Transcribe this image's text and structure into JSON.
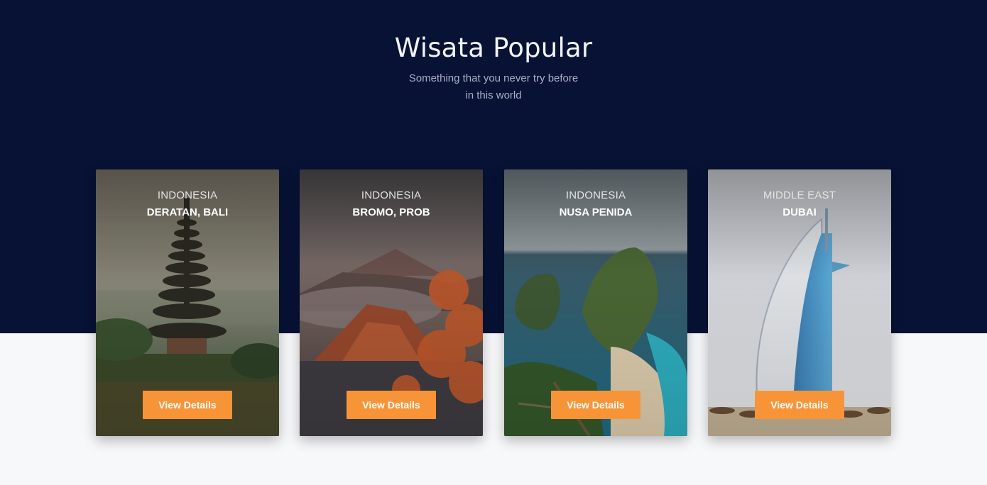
{
  "section": {
    "title": "Wisata Popular",
    "subtitle": "Something that you never try before in this world"
  },
  "colors": {
    "hero_background": "#071235",
    "page_background": "#f7f8fa",
    "button": "#f89438"
  },
  "cards": [
    {
      "country": "INDONESIA",
      "place": "DERATAN, BALI",
      "button_label": "View Details",
      "image": "bali-temple-pagoda"
    },
    {
      "country": "INDONESIA",
      "place": "BROMO, PROB",
      "button_label": "View Details",
      "image": "bromo-volcano"
    },
    {
      "country": "INDONESIA",
      "place": "NUSA PENIDA",
      "button_label": "View Details",
      "image": "nusa-penida-cliffs"
    },
    {
      "country": "MIDDLE EAST",
      "place": "DUBAI",
      "button_label": "View Details",
      "image": "burj-al-arab-tower"
    }
  ]
}
